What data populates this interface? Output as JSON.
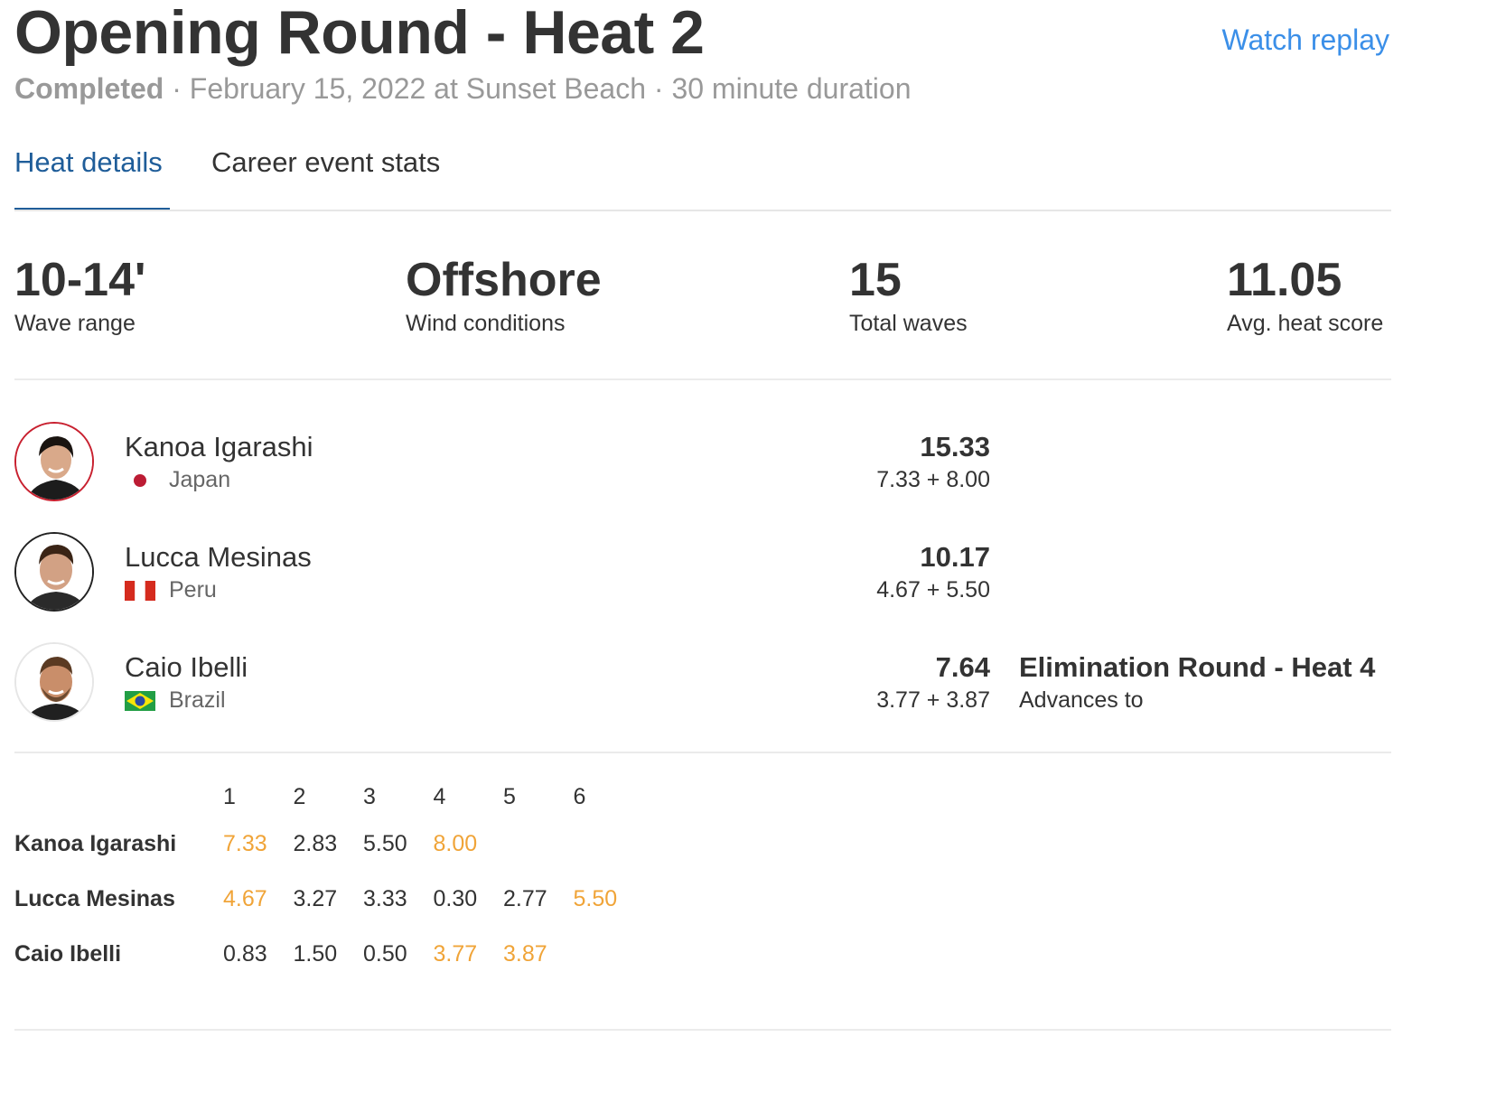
{
  "header": {
    "title": "Opening Round - Heat 2",
    "watch_replay": "Watch replay",
    "status": "Completed",
    "details": " · February 15, 2022 at Sunset Beach · 30 minute duration"
  },
  "tabs": [
    {
      "label": "Heat details",
      "active": true
    },
    {
      "label": "Career event stats",
      "active": false
    }
  ],
  "stats": [
    {
      "value": "10-14'",
      "label": "Wave range"
    },
    {
      "value": "Offshore",
      "label": "Wind conditions"
    },
    {
      "value": "15",
      "label": "Total waves"
    },
    {
      "value": "11.05",
      "label": "Avg. heat score"
    }
  ],
  "surfers": [
    {
      "name": "Kanoa Igarashi",
      "country": "Japan",
      "flag": "japan-flag",
      "total": "15.33",
      "breakdown": "7.33 + 8.00",
      "avatar_ring": "#c8202f"
    },
    {
      "name": "Lucca Mesinas",
      "country": "Peru",
      "flag": "peru-flag",
      "total": "10.17",
      "breakdown": "4.67 + 5.50",
      "avatar_ring": "#222222"
    },
    {
      "name": "Caio Ibelli",
      "country": "Brazil",
      "flag": "brazil-flag",
      "total": "7.64",
      "breakdown": "3.77 + 3.87",
      "avatar_ring": "#e0e0e0",
      "advances_to": "Elimination Round - Heat 4",
      "advances_label": "Advances to"
    }
  ],
  "waves": {
    "headers": [
      "1",
      "2",
      "3",
      "4",
      "5",
      "6"
    ],
    "rows": [
      {
        "name": "Kanoa Igarashi",
        "scores": [
          "7.33",
          "2.83",
          "5.50",
          "8.00",
          "",
          ""
        ],
        "counted": [
          0,
          3
        ]
      },
      {
        "name": "Lucca Mesinas",
        "scores": [
          "4.67",
          "3.27",
          "3.33",
          "0.30",
          "2.77",
          "5.50"
        ],
        "counted": [
          0,
          5
        ]
      },
      {
        "name": "Caio Ibelli",
        "scores": [
          "0.83",
          "1.50",
          "0.50",
          "3.77",
          "3.87",
          ""
        ],
        "counted": [
          3,
          4
        ]
      }
    ]
  },
  "colors": {
    "link": "#3b8fe8",
    "active_tab": "#1f5d99",
    "counted_wave": "#f0a438",
    "muted_text": "#999999"
  }
}
